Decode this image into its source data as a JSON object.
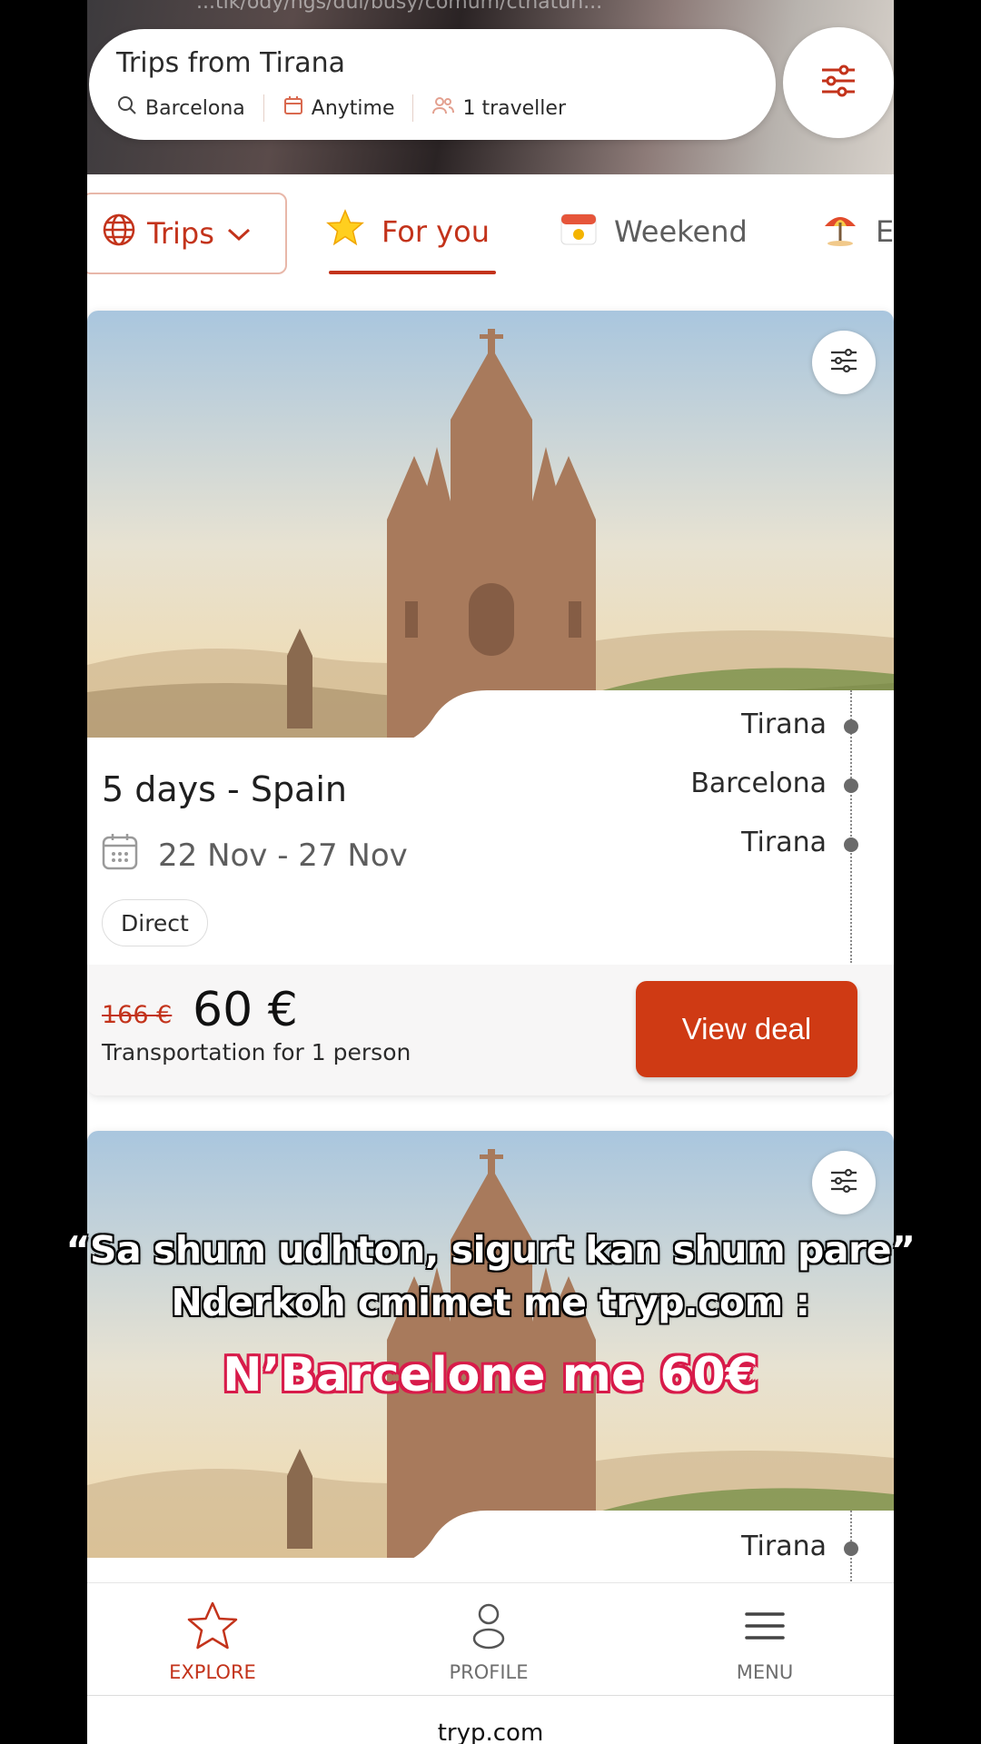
{
  "header": {
    "caption_fragment": "...tik/ody/ngs/dui/busy/comum/ctnatun...",
    "search_title": "Trips from Tirana",
    "destination": "Barcelona",
    "date": "Anytime",
    "travellers": "1 traveller"
  },
  "tabs": {
    "dropdown_label": "Trips",
    "items": [
      {
        "label": "For you",
        "icon": "star-icon",
        "active": true
      },
      {
        "label": "Weekend",
        "icon": "calendar-emoji-icon",
        "active": false
      },
      {
        "label": "E",
        "icon": "beach-umbrella-icon",
        "active": false
      }
    ]
  },
  "cards": [
    {
      "title": "5 days - Spain",
      "dates": "22 Nov - 27 Nov",
      "badge": "Direct",
      "route": [
        "Tirana",
        "Barcelona",
        "Tirana"
      ],
      "old_price": "166 €",
      "price": "60 €",
      "price_note": "Transportation for 1 person",
      "cta": "View deal"
    },
    {
      "route": [
        "Tirana"
      ]
    }
  ],
  "overlay": {
    "line1": "“Sa shum udhton, sigurt kan shum pare”",
    "line2": "Nderkoh cmimet me tryp.com :",
    "line3": "N’Barcelone me 60€"
  },
  "bottom_nav": {
    "items": [
      {
        "label": "EXPLORE",
        "icon": "star-outline-icon",
        "active": true
      },
      {
        "label": "PROFILE",
        "icon": "person-icon",
        "active": false
      },
      {
        "label": "MENU",
        "icon": "hamburger-icon",
        "active": false
      }
    ]
  },
  "url": "tryp.com",
  "colors": {
    "accent": "#c3331b",
    "cta": "#cf3a14",
    "overlay_highlight": "#d81b4a"
  }
}
